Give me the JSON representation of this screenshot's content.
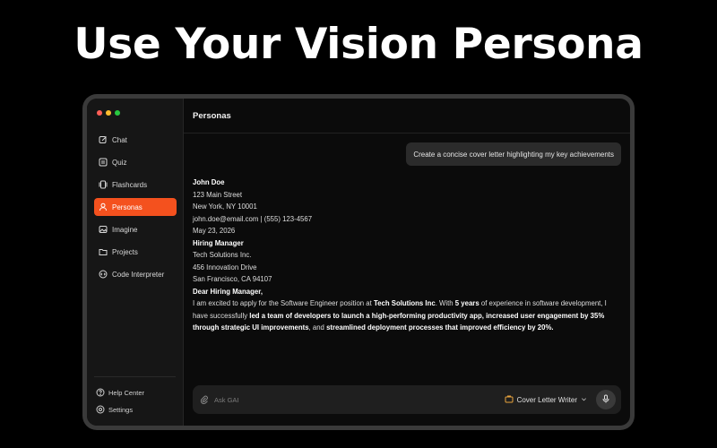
{
  "headline": "Use Your Vision Persona",
  "sidebar": {
    "items": [
      {
        "label": "Chat",
        "icon": "chat-edit-icon",
        "active": false
      },
      {
        "label": "Quiz",
        "icon": "quiz-icon",
        "active": false
      },
      {
        "label": "Flashcards",
        "icon": "flashcards-icon",
        "active": false
      },
      {
        "label": "Personas",
        "icon": "persona-icon",
        "active": true
      },
      {
        "label": "Imagine",
        "icon": "image-icon",
        "active": false
      },
      {
        "label": "Projects",
        "icon": "folder-icon",
        "active": false
      },
      {
        "label": "Code Interpreter",
        "icon": "code-icon",
        "active": false
      }
    ],
    "bottom": [
      {
        "label": "Help Center",
        "icon": "help-icon"
      },
      {
        "label": "Settings",
        "icon": "gear-icon"
      }
    ],
    "accent": "#f4511e"
  },
  "main": {
    "title": "Personas",
    "user_message": "Create a concise cover letter highlighting my key achievements",
    "letter": {
      "name": "John Doe",
      "address1": "123 Main Street",
      "address2": "New York, NY 10001",
      "contact": "john.doe@email.com | (555) 123-4567",
      "date": "May 23, 2026",
      "recipient_title": "Hiring Manager",
      "company": "Tech Solutions Inc.",
      "company_address1": "456 Innovation Drive",
      "company_address2": "San Francisco, CA 94107",
      "salutation": "Dear Hiring Manager,",
      "body_p1": "I am excited to apply for the Software Engineer position at ",
      "body_company": "Tech Solutions Inc",
      "body_p2": ". With ",
      "body_years": "5 years",
      "body_p3": " of experience in software development, I have successfully ",
      "body_bold1": "led a team of developers to launch a high-performing productivity app, increased user engagement by 35% through strategic UI improvements",
      "body_p4": ", and ",
      "body_bold2": "streamlined deployment processes that improved efficiency by 20%.",
      "body_p5": ""
    },
    "composer": {
      "placeholder": "Ask GAI",
      "persona": "Cover Letter Writer"
    }
  }
}
